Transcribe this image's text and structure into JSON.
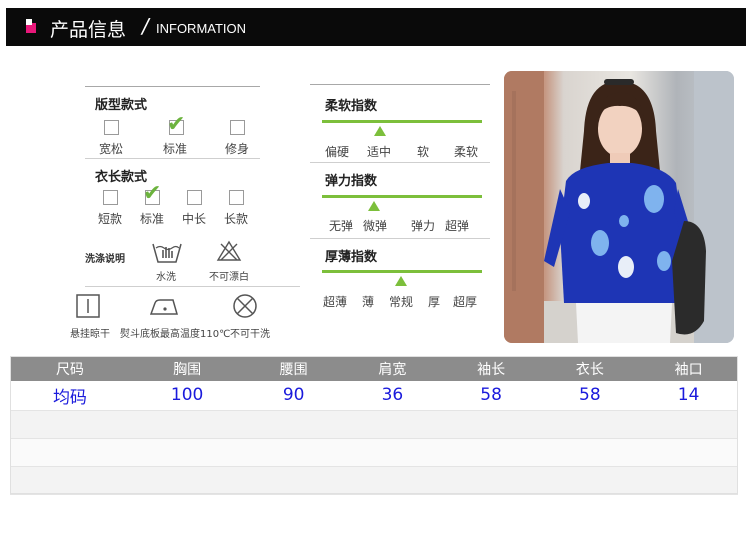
{
  "header": {
    "title": "产品信息",
    "slash": "/",
    "subtitle": "INFORMATION"
  },
  "fit": {
    "title": "版型款式",
    "options": [
      "宽松",
      "标准",
      "修身"
    ],
    "selected": "标准"
  },
  "length": {
    "title": "衣长款式",
    "options": [
      "短款",
      "标准",
      "中长",
      "长款"
    ],
    "selected": "标准"
  },
  "care": {
    "title": "洗涤说明",
    "hand_wash": "水洗",
    "no_bleach": "不可漂白",
    "hang_dry": "悬挂晾干",
    "iron": "熨斗底板最高温度110℃",
    "no_dry_clean": "不可干洗"
  },
  "softness": {
    "title": "柔软指数",
    "scale": [
      "偏硬",
      "适中",
      "软",
      "柔软"
    ],
    "selected": "适中",
    "level_fraction": 0.36
  },
  "elasticity": {
    "title": "弹力指数",
    "scale": [
      "无弹",
      "微弹",
      "弹力",
      "超弹"
    ],
    "selected": "微弹",
    "level_fraction": 0.33
  },
  "thickness": {
    "title": "厚薄指数",
    "scale": [
      "超薄",
      "薄",
      "常规",
      "厚",
      "超厚"
    ],
    "selected": "常规",
    "level_fraction": 0.5
  },
  "colors": {
    "accent": "#e8187a",
    "indicator": "#7cbf3b",
    "table_header_bg": "#8c8c8c",
    "table_value": "#1a1adc",
    "sweater": "#1e35b5"
  },
  "size_table": {
    "headers": [
      "尺码",
      "胸围",
      "腰围",
      "肩宽",
      "袖长",
      "衣长",
      "袖口"
    ],
    "rows": [
      [
        "均码",
        "100",
        "90",
        "36",
        "58",
        "58",
        "14"
      ]
    ]
  }
}
